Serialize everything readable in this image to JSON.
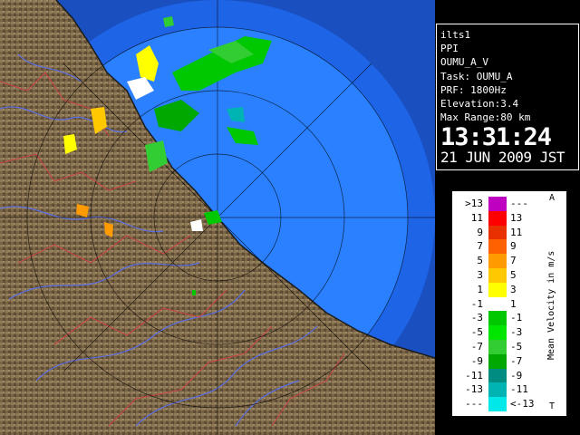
{
  "info": {
    "host": "ilts1",
    "product": "PPI",
    "scan": "OUMU_A_V",
    "task": "Task: OUMU_A",
    "prf": "PRF: 1800Hz",
    "elevation": "Elevation:3.4",
    "max_range": "Max Range:80 km",
    "time": "13:31:24",
    "date": "21 JUN 2009 JST"
  },
  "legend": {
    "title": "Mean Velocity in m/s",
    "top_mark": "A",
    "bottom_mark": "T",
    "rows": [
      {
        "left": ">13",
        "right": "---",
        "color": "#c000c0"
      },
      {
        "left": "11",
        "right": "13",
        "color": "#ff0000"
      },
      {
        "left": "9",
        "right": "11",
        "color": "#e83000"
      },
      {
        "left": "7",
        "right": "9",
        "color": "#ff6000"
      },
      {
        "left": "5",
        "right": "7",
        "color": "#ff9a00"
      },
      {
        "left": "3",
        "right": "5",
        "color": "#ffc800"
      },
      {
        "left": "1",
        "right": "3",
        "color": "#ffff00"
      },
      {
        "left": "-1",
        "right": "1",
        "color": "#ffffff"
      },
      {
        "left": "-3",
        "right": "-1",
        "color": "#00c800"
      },
      {
        "left": "-5",
        "right": "-3",
        "color": "#00e600"
      },
      {
        "left": "-7",
        "right": "-5",
        "color": "#32cd32"
      },
      {
        "left": "-9",
        "right": "-7",
        "color": "#00a800"
      },
      {
        "left": "-11",
        "right": "-9",
        "color": "#008c80"
      },
      {
        "left": "-13",
        "right": "-11",
        "color": "#00b4b4"
      },
      {
        "left": "---",
        "right": "<-13",
        "color": "#00e8e8"
      }
    ]
  },
  "colors": {
    "sea_outer": "#1e64e6",
    "sea_inner": "#2a80ff",
    "land": "#7a6446",
    "rivers": "#5a6ee6",
    "borders": "#c84646"
  }
}
